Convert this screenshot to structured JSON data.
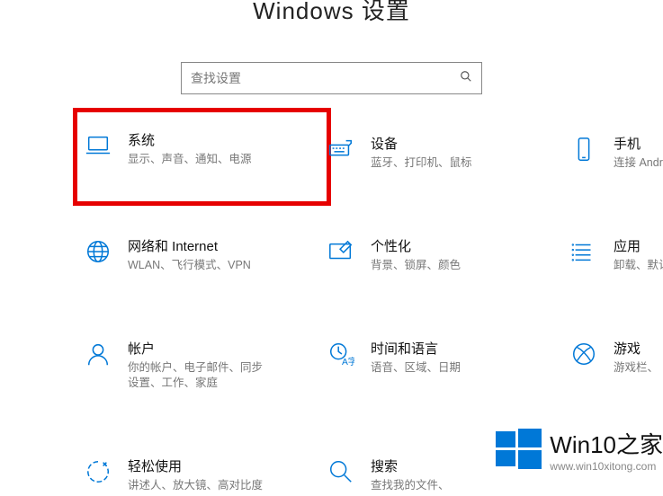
{
  "header": {
    "title": "Windows 设置"
  },
  "search": {
    "placeholder": "查找设置"
  },
  "tiles": [
    {
      "key": "system",
      "icon": "laptop-icon",
      "title": "系统",
      "desc": "显示、声音、通知、电源",
      "highlight": true
    },
    {
      "key": "devices",
      "icon": "keyboard-icon",
      "title": "设备",
      "desc": "蓝牙、打印机、鼠标"
    },
    {
      "key": "phone",
      "icon": "phone-icon",
      "title": "手机",
      "desc": "连接 Android"
    },
    {
      "key": "network",
      "icon": "globe-icon",
      "title": "网络和 Internet",
      "desc": "WLAN、飞行模式、VPN"
    },
    {
      "key": "personal",
      "icon": "brush-icon",
      "title": "个性化",
      "desc": "背景、锁屏、颜色"
    },
    {
      "key": "apps",
      "icon": "apps-icon",
      "title": "应用",
      "desc": "卸载、默认"
    },
    {
      "key": "accounts",
      "icon": "person-icon",
      "title": "帐户",
      "desc": "你的帐户、电子邮件、同步设置、工作、家庭"
    },
    {
      "key": "time",
      "icon": "time-lang-icon",
      "title": "时间和语言",
      "desc": "语音、区域、日期"
    },
    {
      "key": "gaming",
      "icon": "xbox-icon",
      "title": "游戏",
      "desc": "游戏栏、"
    },
    {
      "key": "ease",
      "icon": "ease-icon",
      "title": "轻松使用",
      "desc": "讲述人、放大镜、高对比度"
    },
    {
      "key": "search",
      "icon": "search-icon",
      "title": "搜索",
      "desc": "查找我的文件、"
    }
  ],
  "watermark": {
    "brand": "Win10之家",
    "url": "www.win10xitong.com"
  },
  "colors": {
    "accent": "#0078d7",
    "highlight": "#e60000"
  }
}
